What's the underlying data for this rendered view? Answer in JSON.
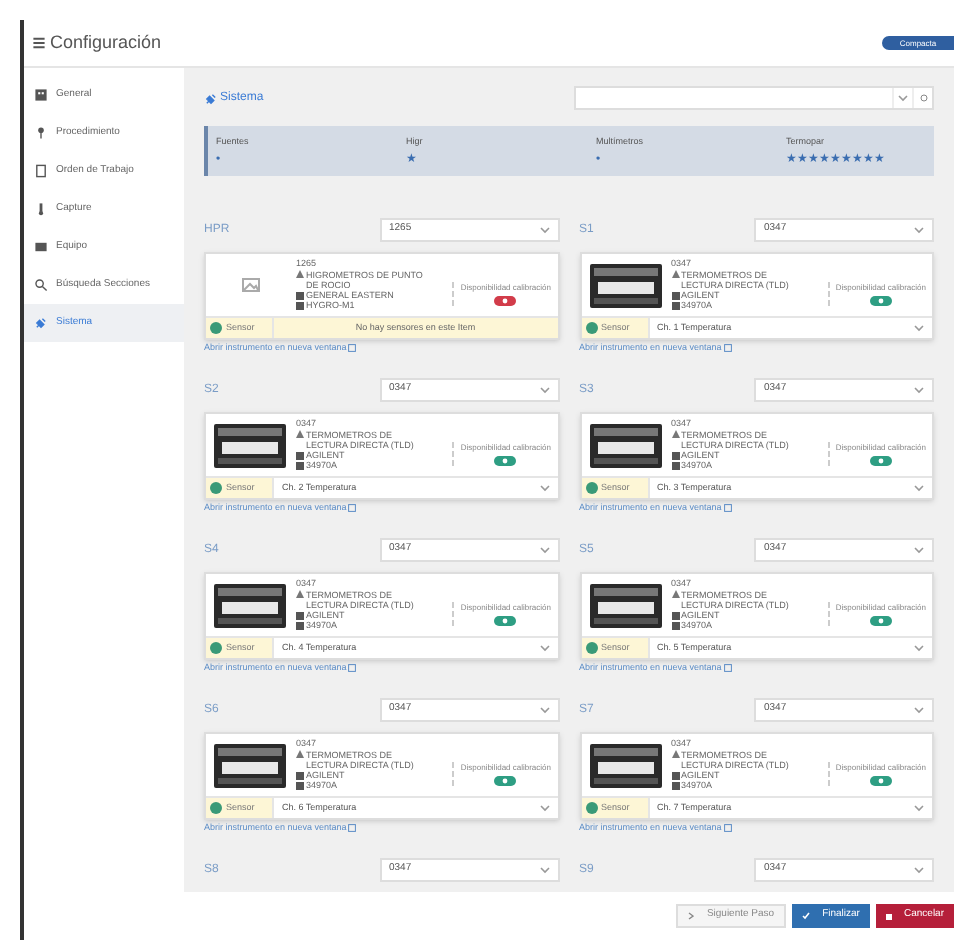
{
  "header": {
    "title": "Configuración",
    "mode_button": "Compacta"
  },
  "sidebar": {
    "items": [
      {
        "label": "General",
        "selected": false
      },
      {
        "label": "Procedimiento",
        "selected": false
      },
      {
        "label": "Orden de Trabajo",
        "selected": false
      },
      {
        "label": "Capture",
        "selected": false
      },
      {
        "label": "Equipo",
        "selected": false
      },
      {
        "label": "Búsqueda Secciones",
        "selected": false
      },
      {
        "label": "Sistema",
        "selected": true
      }
    ]
  },
  "section": {
    "title": "Sistema"
  },
  "summary": [
    {
      "label": "Fuentes",
      "marks": "•"
    },
    {
      "label": "Higr",
      "marks": "★"
    },
    {
      "label": "Multímetros",
      "marks": "•"
    },
    {
      "label": "Termopar",
      "marks": "★★★★★★★★★"
    }
  ],
  "slots": [
    {
      "label": "HPR",
      "value": "1265",
      "card": {
        "kind": "placeholder",
        "id": "1265",
        "type": "HIGROMETROS DE PUNTO DE ROCIO",
        "maker": "GENERAL EASTERN",
        "model": "HYGRO-M1",
        "availability": "Disponibilidad calibración",
        "color": "#d23c4a",
        "sensor": {
          "kind": "message",
          "label": "Sensor",
          "text": "No hay sensores en este Item"
        }
      },
      "link": "Abrir instrumento en nueva ventana"
    },
    {
      "label": "S1",
      "value": "0347",
      "card": {
        "kind": "device",
        "id": "0347",
        "type": "TERMOMETROS DE LECTURA DIRECTA (TLD)",
        "maker": "AGILENT",
        "model": "34970A",
        "availability": "Disponibilidad calibración",
        "color": "#2e9e83",
        "sensor": {
          "kind": "select",
          "label": "Sensor",
          "text": "Ch. 1 Temperatura"
        }
      },
      "link": "Abrir instrumento en nueva ventana"
    },
    {
      "label": "S2",
      "value": "0347",
      "card": {
        "kind": "device",
        "id": "0347",
        "type": "TERMOMETROS DE LECTURA DIRECTA (TLD)",
        "maker": "AGILENT",
        "model": "34970A",
        "availability": "Disponibilidad calibración",
        "color": "#2e9e83",
        "sensor": {
          "kind": "select",
          "label": "Sensor",
          "text": "Ch. 2 Temperatura"
        }
      },
      "link": "Abrir instrumento en nueva ventana"
    },
    {
      "label": "S3",
      "value": "0347",
      "card": {
        "kind": "device",
        "id": "0347",
        "type": "TERMOMETROS DE LECTURA DIRECTA (TLD)",
        "maker": "AGILENT",
        "model": "34970A",
        "availability": "Disponibilidad calibración",
        "color": "#2e9e83",
        "sensor": {
          "kind": "select",
          "label": "Sensor",
          "text": "Ch. 3 Temperatura"
        }
      },
      "link": "Abrir instrumento en nueva ventana"
    },
    {
      "label": "S4",
      "value": "0347",
      "card": {
        "kind": "device",
        "id": "0347",
        "type": "TERMOMETROS DE LECTURA DIRECTA (TLD)",
        "maker": "AGILENT",
        "model": "34970A",
        "availability": "Disponibilidad calibración",
        "color": "#2e9e83",
        "sensor": {
          "kind": "select",
          "label": "Sensor",
          "text": "Ch. 4 Temperatura"
        }
      },
      "link": "Abrir instrumento en nueva ventana"
    },
    {
      "label": "S5",
      "value": "0347",
      "card": {
        "kind": "device",
        "id": "0347",
        "type": "TERMOMETROS DE LECTURA DIRECTA (TLD)",
        "maker": "AGILENT",
        "model": "34970A",
        "availability": "Disponibilidad calibración",
        "color": "#2e9e83",
        "sensor": {
          "kind": "select",
          "label": "Sensor",
          "text": "Ch. 5 Temperatura"
        }
      },
      "link": "Abrir instrumento en nueva ventana"
    },
    {
      "label": "S6",
      "value": "0347",
      "card": {
        "kind": "device",
        "id": "0347",
        "type": "TERMOMETROS DE LECTURA DIRECTA (TLD)",
        "maker": "AGILENT",
        "model": "34970A",
        "availability": "Disponibilidad calibración",
        "color": "#2e9e83",
        "sensor": {
          "kind": "select",
          "label": "Sensor",
          "text": "Ch. 6 Temperatura"
        }
      },
      "link": "Abrir instrumento en nueva ventana"
    },
    {
      "label": "S7",
      "value": "0347",
      "card": {
        "kind": "device",
        "id": "0347",
        "type": "TERMOMETROS DE LECTURA DIRECTA (TLD)",
        "maker": "AGILENT",
        "model": "34970A",
        "availability": "Disponibilidad calibración",
        "color": "#2e9e83",
        "sensor": {
          "kind": "select",
          "label": "Sensor",
          "text": "Ch. 7 Temperatura"
        }
      },
      "link": "Abrir instrumento en nueva ventana"
    },
    {
      "label": "S8",
      "value": "0347"
    },
    {
      "label": "S9",
      "value": "0347"
    }
  ],
  "footer": {
    "buttons": [
      {
        "label": "Siguiente Paso",
        "kind": "next"
      },
      {
        "label": "Finalizar",
        "kind": "finish"
      },
      {
        "label": "Cancelar",
        "kind": "cancel"
      }
    ]
  }
}
